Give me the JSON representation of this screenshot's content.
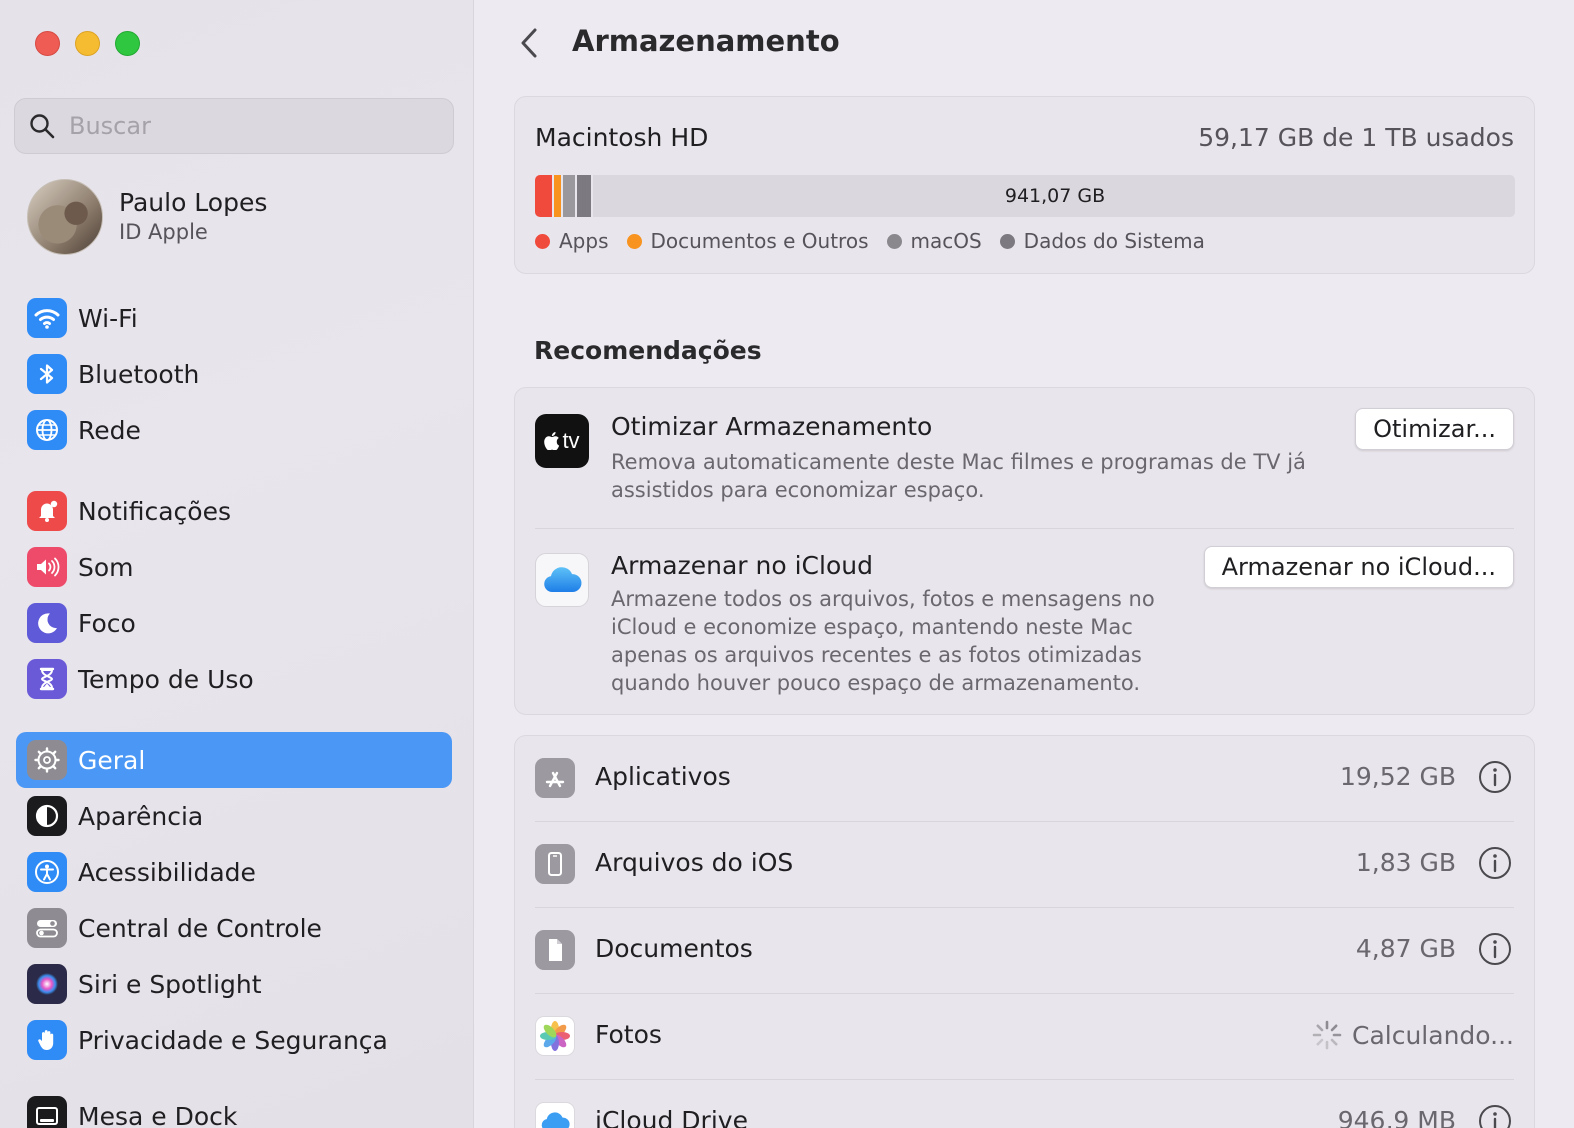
{
  "sidebar": {
    "search_placeholder": "Buscar",
    "profile": {
      "name": "Paulo Lopes",
      "subtitle": "ID Apple"
    },
    "groups": [
      [
        {
          "label": "Wi-Fi",
          "icon": "wifi-icon",
          "color": "#2f8bf6"
        },
        {
          "label": "Bluetooth",
          "icon": "bluetooth-icon",
          "color": "#2f8bf6"
        },
        {
          "label": "Rede",
          "icon": "globe-icon",
          "color": "#2f8bf6"
        }
      ],
      [
        {
          "label": "Notificações",
          "icon": "bell-icon",
          "color": "#ee4a4a"
        },
        {
          "label": "Som",
          "icon": "speaker-icon",
          "color": "#ee4a6a"
        },
        {
          "label": "Foco",
          "icon": "moon-icon",
          "color": "#5f5ad8"
        },
        {
          "label": "Tempo de Uso",
          "icon": "hourglass-icon",
          "color": "#6a5ad8"
        }
      ],
      [
        {
          "label": "Geral",
          "icon": "gear-icon",
          "color": "#8e8c92",
          "active": true
        },
        {
          "label": "Aparência",
          "icon": "appearance-icon",
          "color": "#1b1b1d"
        },
        {
          "label": "Acessibilidade",
          "icon": "accessibility-icon",
          "color": "#2f8bf6"
        },
        {
          "label": "Central de Controle",
          "icon": "control-center-icon",
          "color": "#8e8c92"
        },
        {
          "label": "Siri e Spotlight",
          "icon": "siri-icon",
          "color": "#2b2a48"
        },
        {
          "label": "Privacidade e Segurança",
          "icon": "hand-icon",
          "color": "#2f8bf6"
        }
      ],
      [
        {
          "label": "Mesa e Dock",
          "icon": "dock-icon",
          "color": "#1b1b1d"
        }
      ]
    ]
  },
  "main": {
    "title": "Armazenamento",
    "disk": {
      "name": "Macintosh HD",
      "usage": "59,17 GB de 1 TB usados",
      "free_label": "941,07 GB",
      "used_fraction": 0.0592,
      "segments": [
        {
          "name": "Apps",
          "color": "#f04a3c",
          "fraction": 0.0195
        },
        {
          "name": "Documentos e Outros",
          "color": "#f7931e",
          "fraction": 0.009
        },
        {
          "name": "macOS",
          "color": "#9a989d",
          "fraction": 0.014
        },
        {
          "name": "Dados do Sistema",
          "color": "#7c7a80",
          "fraction": 0.0167
        }
      ]
    },
    "recommendations_title": "Recomendações",
    "recommendations": [
      {
        "title": "Otimizar Armazenamento",
        "description": "Remova automaticamente deste Mac filmes e programas de TV já assistidos para economizar espaço.",
        "button": "Otimizar...",
        "icon": "apple-tv-icon",
        "icon_text": "tv"
      },
      {
        "title": "Armazenar no iCloud",
        "description": "Armazene todos os arquivos, fotos e mensagens no iCloud e economize espaço, mantendo neste Mac apenas os arquivos recentes e as fotos otimizadas quando houver pouco espaço de armazenamento.",
        "button": "Armazenar no iCloud...",
        "icon": "icloud-icon"
      }
    ],
    "categories": [
      {
        "name": "Aplicativos",
        "size": "19,52 GB",
        "icon": "app-store-icon"
      },
      {
        "name": "Arquivos do iOS",
        "size": "1,83 GB",
        "icon": "iphone-icon"
      },
      {
        "name": "Documentos",
        "size": "4,87 GB",
        "icon": "document-icon"
      },
      {
        "name": "Fotos",
        "size": "Calculando...",
        "icon": "photos-icon",
        "calculating": true
      },
      {
        "name": "iCloud Drive",
        "size": "946,9 MB",
        "icon": "icloud-drive-icon"
      }
    ]
  }
}
